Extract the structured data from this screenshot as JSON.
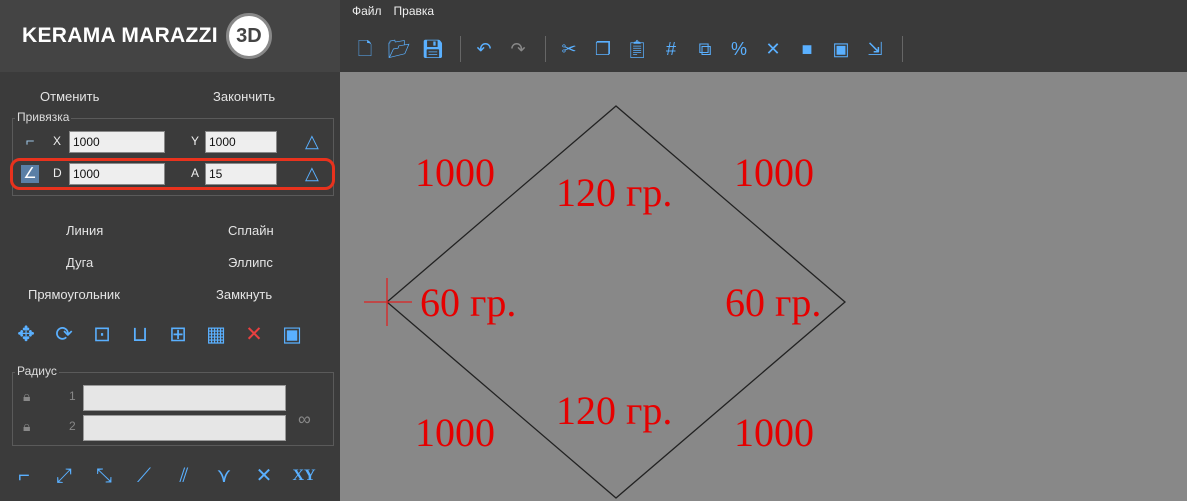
{
  "logo": {
    "brand": "KERAMA MARAZZI",
    "badge": "3D"
  },
  "menu": {
    "file": "Файл",
    "edit": "Правка"
  },
  "actions": {
    "undo": "Отменить",
    "finish": "Закончить"
  },
  "snap": {
    "legend": "Привязка",
    "x_label": "X",
    "x_value": "1000",
    "y_label": "Y",
    "y_value": "1000",
    "d_label": "D",
    "d_value": "1000",
    "a_label": "A",
    "a_value": "15"
  },
  "draw": {
    "line": "Линия",
    "spline": "Сплайн",
    "arc": "Дуга",
    "ellipse": "Эллипс",
    "rect": "Прямоугольник",
    "close": "Замкнуть"
  },
  "radius": {
    "legend": "Радиус",
    "n1": "1",
    "n2": "2"
  },
  "bottom": {
    "xy": "XY"
  },
  "canvas": {
    "labels": {
      "top_left": "1000",
      "top_right": "1000",
      "bottom_left": "1000",
      "bottom_right": "1000",
      "top_angle": "120 гр.",
      "bottom_angle": "120 гр.",
      "left_angle": "60 гр.",
      "right_angle": "60 гр."
    }
  },
  "colors": {
    "accent": "#5ab0ff",
    "annotation": "#e60000",
    "highlight": "#e8321d",
    "canvas": "#888888"
  }
}
